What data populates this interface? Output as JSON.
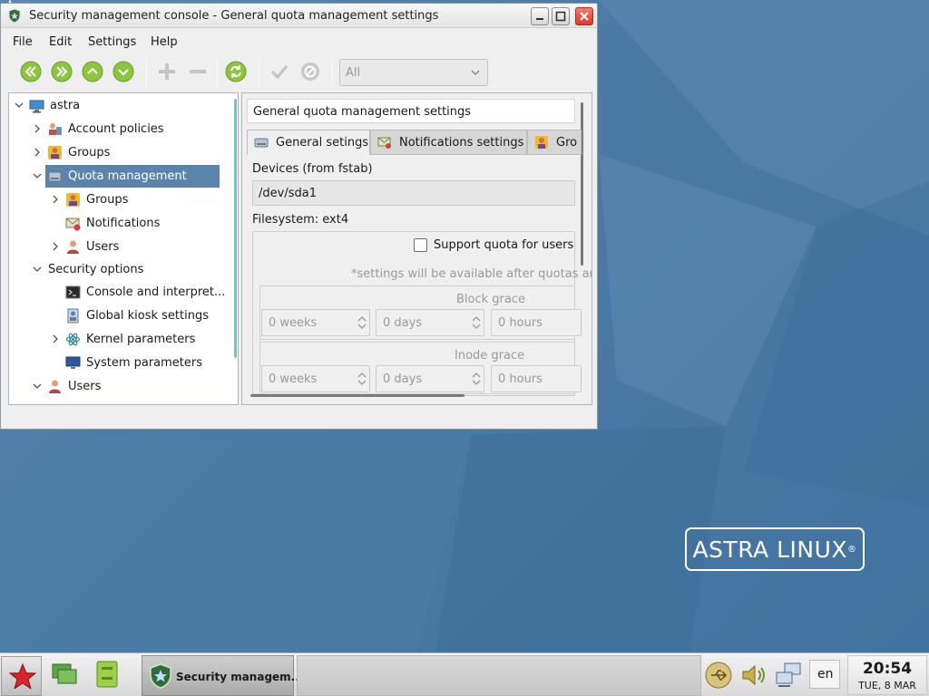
{
  "window": {
    "title": "Security management console - General quota management settings"
  },
  "menu": [
    "File",
    "Edit",
    "Settings",
    "Help"
  ],
  "toolbar": {
    "filter_value": "All"
  },
  "tree": {
    "items": [
      {
        "label": "astra",
        "icon": "computer-icon"
      },
      {
        "label": "Account policies",
        "icon": "account-policies-icon"
      },
      {
        "label": "Groups",
        "icon": "groups-icon"
      },
      {
        "label": "Quota management",
        "icon": "disk-icon"
      },
      {
        "label": "Groups",
        "icon": "groups-icon"
      },
      {
        "label": "Notifications",
        "icon": "notifications-icon"
      },
      {
        "label": "Users",
        "icon": "user-icon"
      },
      {
        "label": "Security options",
        "icon": ""
      },
      {
        "label": "Console and interpret...",
        "icon": "console-icon"
      },
      {
        "label": "Global kiosk settings",
        "icon": "kiosk-icon"
      },
      {
        "label": "Kernel parameters",
        "icon": "atom-icon"
      },
      {
        "label": "System parameters",
        "icon": "monitor-icon"
      },
      {
        "label": "Users",
        "icon": "user-icon"
      }
    ]
  },
  "panel": {
    "header": "General quota management settings",
    "tabs": [
      "General setings",
      "Notifications settings",
      "Gro"
    ],
    "devices_label": "Devices (from fstab)",
    "device_value": "/dev/sda1",
    "filesystem_label": "Filesystem: ext4",
    "support_quota_label": "Support quota for users",
    "note": "*settings will be available after quotas are",
    "block_grace": {
      "title": "Block grace",
      "weeks": "0 weeks",
      "days": "0 days",
      "hours": "0 hours"
    },
    "inode_grace": {
      "title": "Inode grace",
      "weeks": "0 weeks",
      "days": "0 days",
      "hours": "0 hours"
    }
  },
  "desktop": {
    "logo_text": "ASTRA LINUX",
    "logo_mark": "®"
  },
  "taskbar": {
    "task_label": "Security managem...",
    "language": "en",
    "time": "20:54",
    "date": "TUE, 8 MAR"
  },
  "colors": {
    "desktop": "#4b7aa6",
    "selection": "#5b84ad",
    "toolbar_green": "#8cc63f"
  }
}
